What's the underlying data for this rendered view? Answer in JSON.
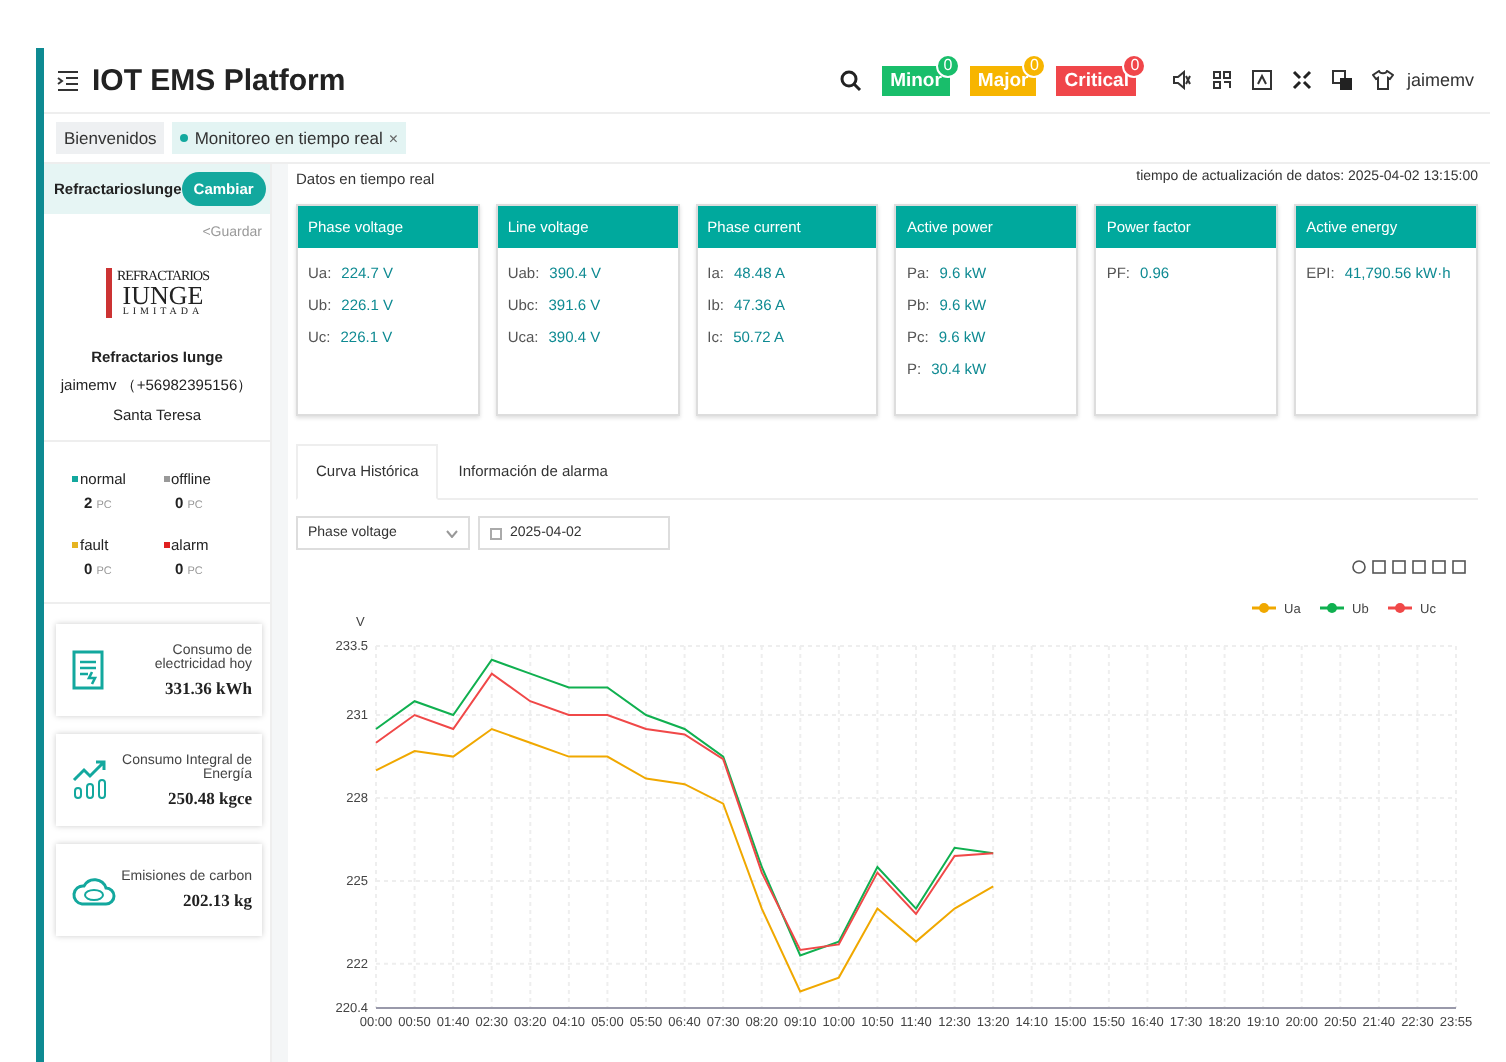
{
  "header": {
    "title": "IOT EMS Platform",
    "alarm_badges": [
      {
        "label": "Minor",
        "count": "0",
        "color": "#19be6b"
      },
      {
        "label": "Major",
        "count": "0",
        "color": "#f7b500"
      },
      {
        "label": "Critical",
        "count": "0",
        "color": "#f0464a"
      }
    ],
    "user": "jaimemv"
  },
  "page_tabs": [
    {
      "label": "Bienvenidos",
      "selected": false,
      "closable": false
    },
    {
      "label": "Monitoreo en tiempo real",
      "selected": true,
      "closable": true,
      "close": "×"
    }
  ],
  "sidebar": {
    "site": "RefractariosIunge",
    "switch_button": "Cambiar",
    "save_link": "<Guardar",
    "logo": {
      "line_1": "REFRACTARIOS",
      "line_2": "IUNGE",
      "line_3": "LIMITADA"
    },
    "company": "Refractarios Iunge",
    "contact": "jaimemv （+56982395156）",
    "location": "Santa Teresa",
    "status": [
      {
        "label": "normal",
        "count": "2",
        "unit": "PC",
        "color": "#13a89e"
      },
      {
        "label": "offline",
        "count": "0",
        "unit": "PC",
        "color": "#999999"
      },
      {
        "label": "fault",
        "count": "0",
        "unit": "PC",
        "color": "#e6b422"
      },
      {
        "label": "alarm",
        "count": "0",
        "unit": "PC",
        "color": "#e02020"
      }
    ],
    "summary": [
      {
        "kind": "document",
        "title": "Consumo de electricidad hoy",
        "value": "331.36 kWh"
      },
      {
        "kind": "growth",
        "title": "Consumo Integral de Energía",
        "value": "250.48 kgce"
      },
      {
        "kind": "co2",
        "title": "Emisiones de carbon",
        "value": "202.13 kg"
      }
    ]
  },
  "main": {
    "heading": "Datos en tiempo real",
    "update_time": "tiempo de actualización de datos: 2025-04-02 13:15:00",
    "metric_cards": [
      {
        "title": "Phase voltage",
        "rows": [
          {
            "label": "Ua:",
            "value": "224.7 V"
          },
          {
            "label": "Ub:",
            "value": "226.1 V"
          },
          {
            "label": "Uc:",
            "value": "226.1 V"
          }
        ]
      },
      {
        "title": "Line voltage",
        "rows": [
          {
            "label": "Uab:",
            "value": "390.4 V"
          },
          {
            "label": "Ubc:",
            "value": "391.6 V"
          },
          {
            "label": "Uca:",
            "value": "390.4 V"
          }
        ]
      },
      {
        "title": "Phase current",
        "rows": [
          {
            "label": "Ia:",
            "value": "48.48 A"
          },
          {
            "label": "Ib:",
            "value": "47.36 A"
          },
          {
            "label": "Ic:",
            "value": "50.72 A"
          }
        ]
      },
      {
        "title": "Active power",
        "rows": [
          {
            "label": "Pa:",
            "value": "9.6 kW"
          },
          {
            "label": "Pb:",
            "value": "9.6 kW"
          },
          {
            "label": "Pc:",
            "value": "9.6 kW"
          },
          {
            "label": "P:",
            "value": "30.4 kW"
          }
        ]
      },
      {
        "title": "Power factor",
        "rows": [
          {
            "label": "PF:",
            "value": "0.96"
          }
        ]
      },
      {
        "title": "Active energy",
        "rows": [
          {
            "label": "EPI:",
            "value": "41,790.56 kW·h"
          }
        ]
      }
    ],
    "tabs": [
      {
        "label": "Curva Histórica",
        "selected": true
      },
      {
        "label": "Información de alarma",
        "selected": false
      }
    ],
    "parameter_select": "Phase voltage",
    "date_field": "2025-04-02",
    "chart_data": {
      "type": "line",
      "ylabel": "V",
      "grid": true,
      "legend": true,
      "categories": [
        "00:00",
        "00:50",
        "01:40",
        "02:30",
        "03:20",
        "04:10",
        "05:00",
        "05:50",
        "06:40",
        "07:30",
        "08:20",
        "09:10",
        "10:00",
        "10:50",
        "11:40",
        "12:30",
        "13:20",
        "14:10",
        "15:00",
        "15:50",
        "16:40",
        "17:30",
        "18:20",
        "19:10",
        "20:00",
        "20:50",
        "21:40",
        "22:30",
        "23:55"
      ],
      "series": [
        {
          "name": "Ua",
          "color": "#f0a800",
          "values": [
            229,
            229.7,
            229.5,
            230.5,
            230,
            229.5,
            229.5,
            228.7,
            228.5,
            227.8,
            224,
            221,
            221.5,
            224,
            222.8,
            224,
            224.8,
            null,
            null,
            null,
            null,
            null,
            null,
            null,
            null,
            null,
            null,
            null,
            null
          ]
        },
        {
          "name": "Ub",
          "color": "#10b050",
          "values": [
            230.5,
            231.5,
            231,
            233,
            232.5,
            232,
            232,
            231,
            230.5,
            229.5,
            225.5,
            222.3,
            222.8,
            225.5,
            224,
            226.2,
            226,
            null,
            null,
            null,
            null,
            null,
            null,
            null,
            null,
            null,
            null,
            null,
            null
          ]
        },
        {
          "name": "Uc",
          "color": "#f04848",
          "values": [
            230,
            231,
            230.5,
            232.5,
            231.5,
            231,
            231,
            230.5,
            230.3,
            229.4,
            225.3,
            222.5,
            222.7,
            225.3,
            223.8,
            225.9,
            226,
            null,
            null,
            null,
            null,
            null,
            null,
            null,
            null,
            null,
            null,
            null,
            null
          ]
        }
      ],
      "ylim": [
        220.4,
        233.5
      ],
      "yticks": [
        220.4,
        222,
        225,
        228,
        231,
        233.5
      ]
    }
  }
}
